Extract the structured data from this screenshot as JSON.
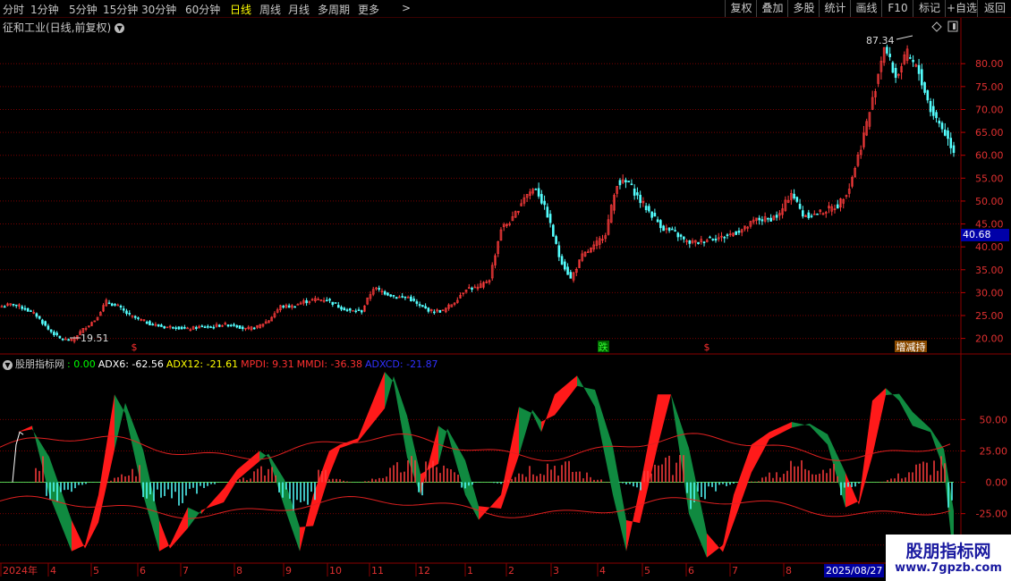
{
  "toolbar": {
    "periods": [
      "分时",
      "1分钟",
      "5分钟",
      "15分钟",
      "30分钟",
      "60分钟",
      "日线",
      "周线",
      "月线",
      "多周期",
      "更多"
    ],
    "active_period": "日线",
    "more_arrow": ">",
    "tools": [
      "复权",
      "叠加",
      "多股",
      "统计",
      "画线",
      "F10",
      "标记",
      "+自选",
      "返回"
    ]
  },
  "title": {
    "stock": "征和工业(日线,前复权)",
    "toggle_icon": "chevron-down"
  },
  "price_axis": {
    "ticks": [
      "80.00",
      "75.00",
      "70.00",
      "65.00",
      "60.00",
      "55.00",
      "50.00",
      "45.00",
      "40.00",
      "35.00",
      "30.00",
      "25.00",
      "20.00"
    ],
    "current_price": "40.68",
    "high_label": "87.34",
    "low_label": "19.51"
  },
  "markers": [
    {
      "text": "$",
      "color": "#ff3030"
    },
    {
      "text": "跌",
      "color": "#30ff30"
    },
    {
      "text": "$",
      "color": "#ff3030"
    },
    {
      "text": "增减持",
      "color": "#ffffff"
    }
  ],
  "indicator": {
    "name": "股朋指标网",
    "value0": ": 0.00",
    "adx6": "ADX6: -62.56",
    "adx12": "ADX12: -21.61",
    "mpdi": "MPDI: 9.31",
    "mmdi": "MMDI: -36.38",
    "adxcd": "ADXCD: -21.87",
    "colors": {
      "name": "#c8c8c8",
      "value0": "#00ff00",
      "adx6": "#ffffff",
      "adx12": "#ffff00",
      "mpdi": "#ff3030",
      "mmdi": "#ff3030",
      "adxcd": "#3030ff"
    },
    "axis_ticks": [
      "50.00",
      "25.00",
      "0.00",
      "-25.00",
      "-50.00"
    ]
  },
  "date_axis": {
    "labels": [
      "2024年",
      "4",
      "5",
      "6",
      "7",
      "8",
      "9",
      "10",
      "11",
      "12",
      "1",
      "2",
      "3",
      "4",
      "5",
      "6",
      "7",
      "8"
    ],
    "highlight": "2025/08/27"
  },
  "watermark": {
    "name": "股朋指标网",
    "url": "www.7gpzb.com"
  },
  "chart_data": {
    "type": "candlestick",
    "y_range": [
      17,
      90
    ],
    "close_series": [
      27,
      27.5,
      26.5,
      25,
      22,
      20,
      19.5,
      22,
      24,
      28,
      27,
      25,
      24,
      23,
      22.5,
      22.5,
      22,
      22.5,
      22.5,
      23,
      23,
      22,
      22.5,
      24,
      27,
      27,
      28,
      28.5,
      28.5,
      27,
      26,
      26,
      31,
      30,
      29,
      29,
      27,
      26,
      26,
      28,
      31,
      31,
      33,
      44,
      46,
      51,
      53,
      47,
      38,
      33,
      38,
      40,
      43,
      54,
      54,
      50,
      47,
      44,
      43,
      41,
      41,
      42,
      42,
      43,
      44,
      46,
      46,
      47,
      52,
      47,
      47,
      48,
      49,
      53,
      62,
      72,
      84,
      77,
      82,
      78,
      70,
      66,
      61
    ],
    "indicator_y_range": [
      -63,
      88
    ]
  }
}
